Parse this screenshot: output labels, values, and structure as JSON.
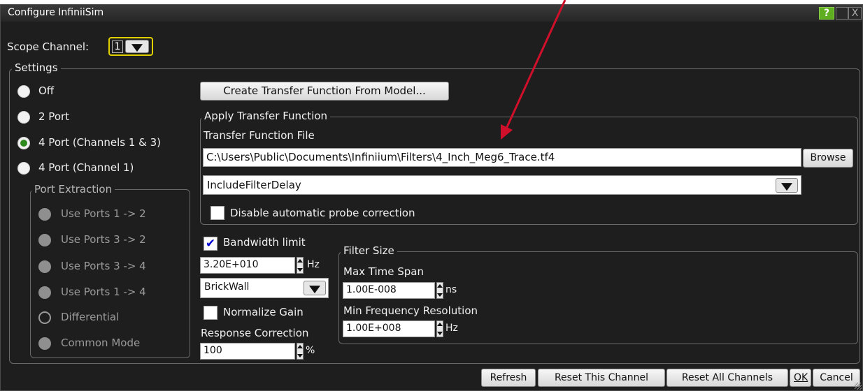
{
  "window": {
    "title": "Configure InfiniiSim",
    "help_label": "?",
    "close_label": "X"
  },
  "scope_channel": {
    "label": "Scope Channel:",
    "value": "1"
  },
  "settings": {
    "legend": "Settings",
    "modes": [
      {
        "label": "Off",
        "checked": false
      },
      {
        "label": "2 Port",
        "checked": false
      },
      {
        "label": "4 Port (Channels 1 & 3)",
        "checked": true
      },
      {
        "label": "4 Port (Channel 1)",
        "checked": false
      }
    ],
    "port_extraction": {
      "legend": "Port Extraction",
      "options": [
        {
          "label": "Use Ports 1 -> 2"
        },
        {
          "label": "Use Ports 3 -> 2"
        },
        {
          "label": "Use Ports 3 -> 4"
        },
        {
          "label": "Use Ports 1 -> 4"
        },
        {
          "label": "Differential"
        },
        {
          "label": "Common Mode"
        }
      ]
    },
    "create_button": "Create Transfer Function From Model...",
    "apply": {
      "legend": "Apply Transfer Function",
      "file_label": "Transfer Function File",
      "file_path": "C:\\Users\\Public\\Documents\\Infiniium\\Filters\\4_Inch_Meg6_Trace.tf4",
      "browse_label": "Browse",
      "delay_option": "IncludeFilterDelay",
      "disable_probe_label": "Disable automatic probe correction"
    },
    "bandwidth": {
      "limit_label": "Bandwidth limit",
      "limit_checked": true,
      "value": "3.20E+010",
      "unit": "Hz",
      "filter_type": "BrickWall",
      "normalize_label": "Normalize Gain",
      "response_label": "Response Correction",
      "response_value": "100",
      "response_unit": "%"
    },
    "filter_size": {
      "legend": "Filter Size",
      "max_span_label": "Max Time Span",
      "max_span_value": "1.00E-008",
      "max_span_unit": "ns",
      "min_freq_label": "Min Frequency Resolution",
      "min_freq_value": "1.00E+008",
      "min_freq_unit": "Hz"
    }
  },
  "footer": {
    "refresh": "Refresh",
    "reset_channel": "Reset This Channel",
    "reset_all": "Reset All Channels",
    "ok": "OK",
    "cancel": "Cancel"
  },
  "colors": {
    "window_bg": "#1e1e1e",
    "accent_yellow": "#e0d000",
    "radio_checked": "#2f8a1d",
    "arrow": "#d0102a"
  }
}
